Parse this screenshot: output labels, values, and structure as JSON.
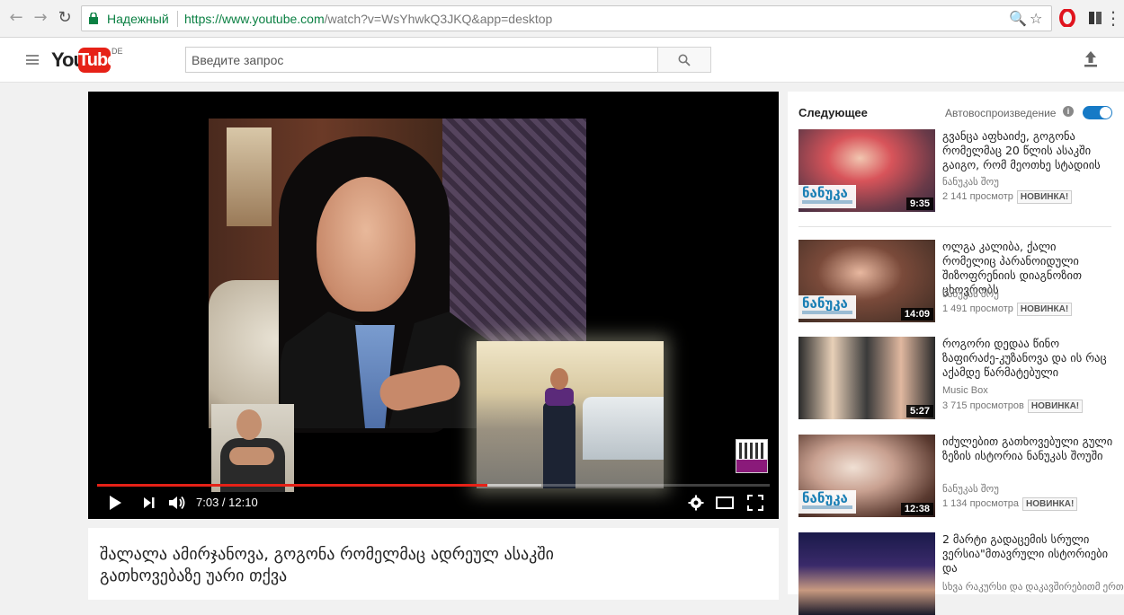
{
  "browser": {
    "secure_label": "Надежный",
    "url_host": "https://www.youtube.com",
    "url_rest": "/watch?v=WsYhwkQ3JKQ&app=desktop",
    "accent_green": "#0b8043"
  },
  "masthead": {
    "logo_you": "You",
    "logo_tube": "Tube",
    "country_code": "DE",
    "search_placeholder": "Введите запрос",
    "brand_red": "#e62117"
  },
  "player": {
    "current_time": "7:03",
    "duration": "12:10",
    "time_display": "7:03 / 12:10",
    "progress_played_fraction": 0.58,
    "progress_buffered_fraction": 0.66
  },
  "video": {
    "title": "შალალა ამირჯანოვა, გოგონა რომელმაც ადრეულ ასაკში გათხოვებაზე უარი თქვა"
  },
  "sidebar": {
    "up_next_label": "Следующее",
    "autoplay_label": "Автовоспроизведение",
    "autoplay_on": true,
    "new_badge": "НОВИНКА!",
    "items": [
      {
        "title": "გვანცა აფხაიძე, გოგონა რომელმაც 20 წლის ასაკში გაიგო, რომ მეოთხე სტადიის",
        "channel": "ნანუკას შოუ",
        "views": "2 141 просмотр",
        "duration": "9:35"
      },
      {
        "title": "ოლგა კალიბა, ქალი რომელიც პარანოიდული შიზოფრენიის დიაგნოზით ცხოვრობს",
        "channel": "ნანუკას შოუ",
        "views": "1 491 просмотр",
        "duration": "14:09"
      },
      {
        "title": "როგორი დედაა წინო ზაფირაძე-კუზანოვა და ის რაც აქამდე წარმატებული",
        "channel": "Music Box",
        "views": "3 715 просмотров",
        "duration": "5:27"
      },
      {
        "title": "იძულებით გათხოვებული გული ზეზის ისტორია ნანუკას შოუში",
        "channel": "ნანუკას შოუ",
        "views": "1 134 просмотра",
        "duration": "12:38"
      },
      {
        "title": "2 მარტი გადაცემის სრული ვერსია\"მთავრული ისტორიები და",
        "channel": "სხვა რაკურსი და დაკავშირებითმ ერთად"
      }
    ]
  }
}
